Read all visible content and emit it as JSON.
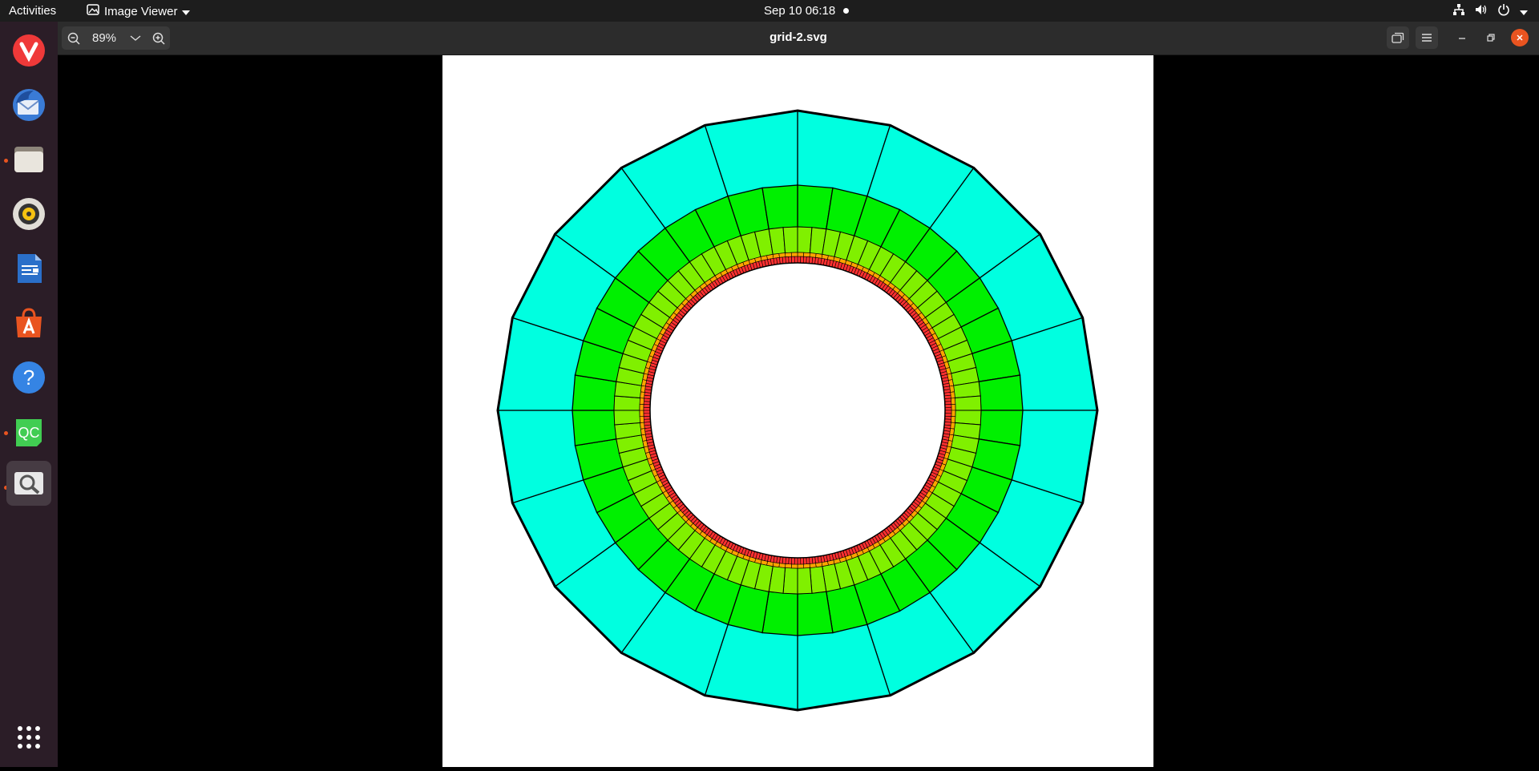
{
  "topbar": {
    "activities": "Activities",
    "app_name": "Image Viewer",
    "datetime": "Sep 10  06:18"
  },
  "dock": {
    "apps": [
      {
        "name": "vivaldi-icon",
        "color": "#ef3939",
        "running": false
      },
      {
        "name": "thunderbird-icon",
        "color": "#3a7bd5",
        "running": false
      },
      {
        "name": "files-icon",
        "color": "#cfc9bd",
        "running": true
      },
      {
        "name": "rhythmbox-icon",
        "color": "#f5c211",
        "running": false
      },
      {
        "name": "writer-icon",
        "color": "#2a6fc9",
        "running": false
      },
      {
        "name": "software-icon",
        "color": "#e95420",
        "running": false
      },
      {
        "name": "help-icon",
        "color": "#3584e4",
        "running": false
      },
      {
        "name": "qc-icon",
        "color": "#41cd52",
        "label": "QC",
        "running": true
      },
      {
        "name": "image-viewer-icon",
        "color": "#9a9a9a",
        "running": true
      }
    ]
  },
  "viewer": {
    "zoom": "89%",
    "title": "grid-2.svg"
  },
  "image": {
    "colors": {
      "outer": "#00ffe0",
      "ring2": "#00f000",
      "ring3": "#80f000",
      "ring4": "#ffa500",
      "ring5": "#ff3030"
    }
  }
}
